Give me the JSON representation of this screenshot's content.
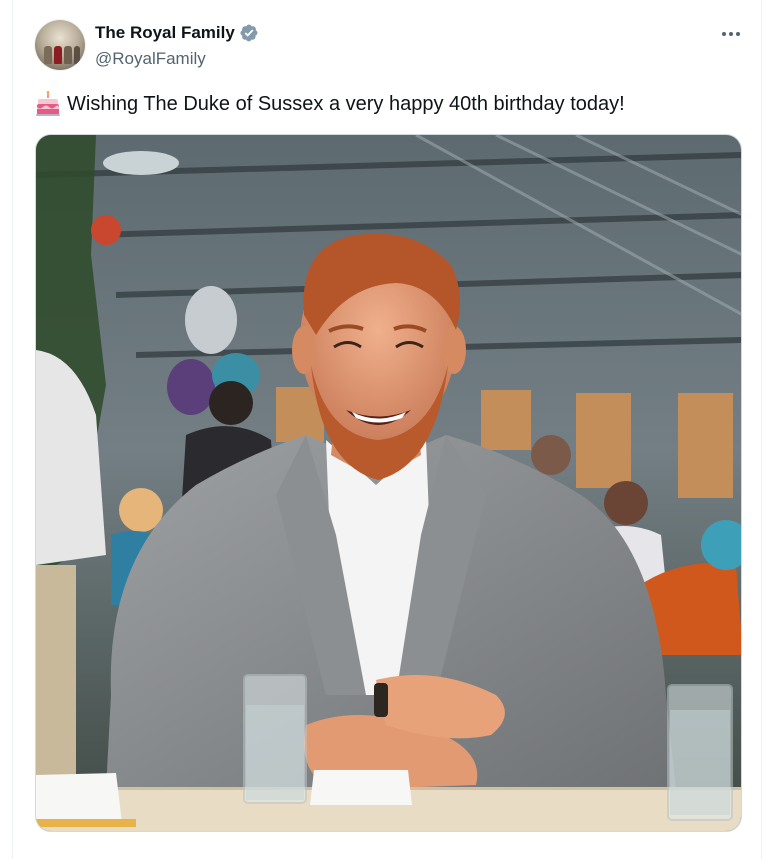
{
  "author": {
    "name": "The Royal Family",
    "handle": "@RoyalFamily",
    "verified": true,
    "verified_color": "#829aab"
  },
  "menu_icon": "more-horizontal-icon",
  "tweet": {
    "emoji": "birthday-cake-icon",
    "text": "Wishing The Duke of Sussex a very happy 40th birthday today!"
  },
  "colors": {
    "text_primary": "#0f1419",
    "text_secondary": "#536471",
    "border": "#cfd9de"
  }
}
